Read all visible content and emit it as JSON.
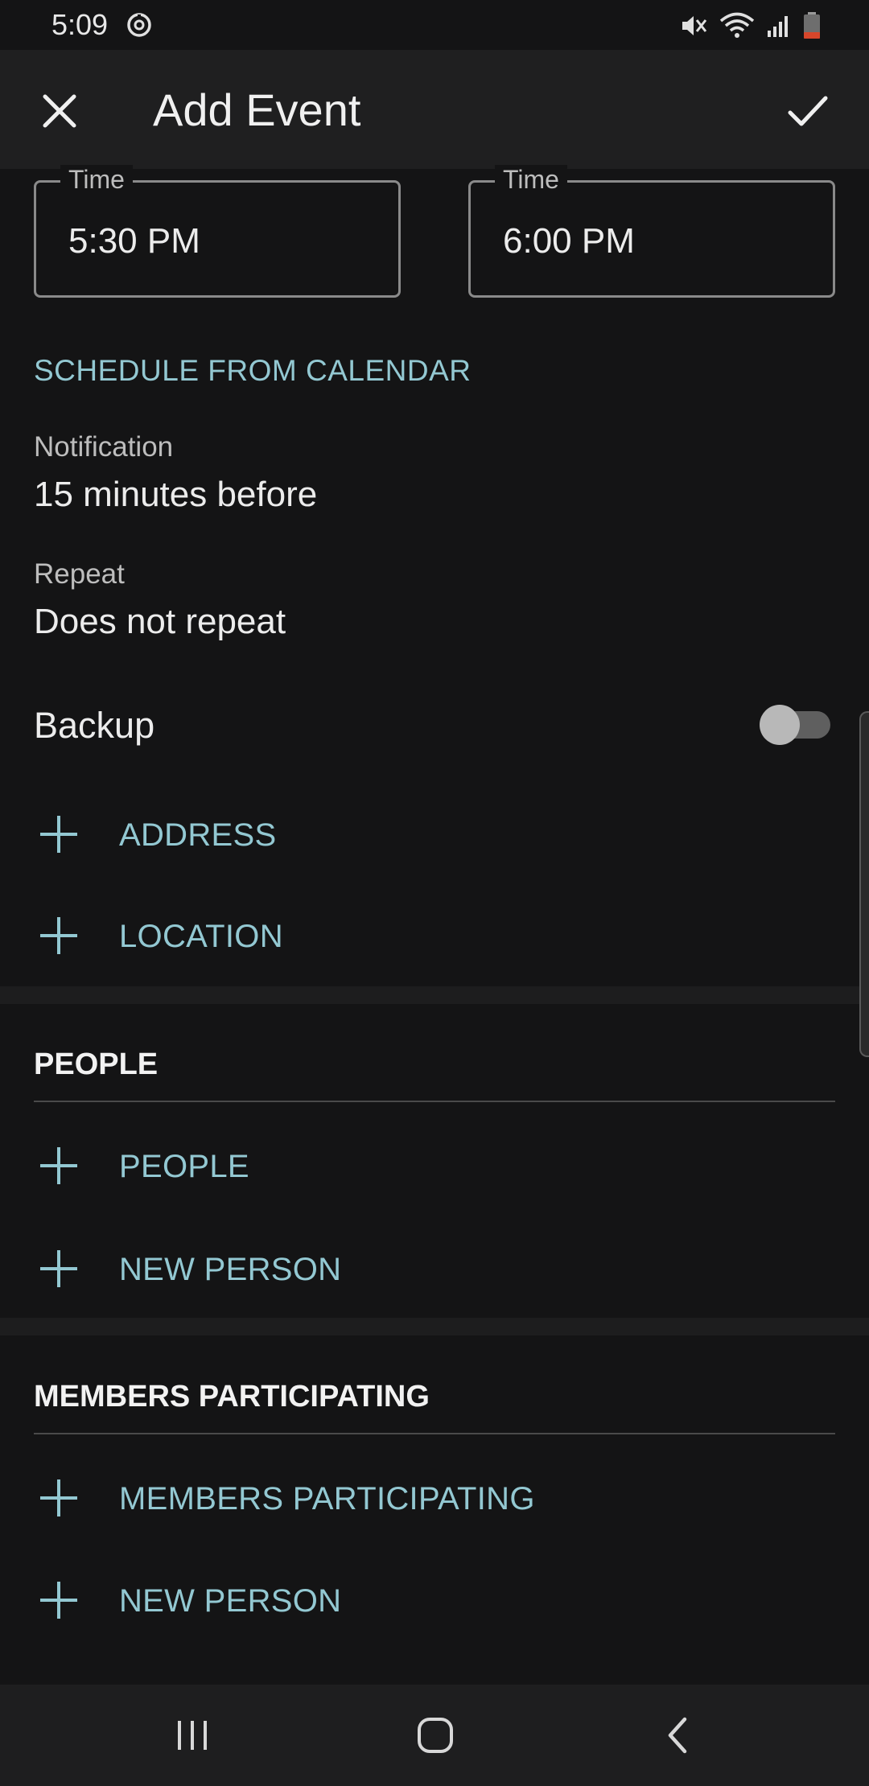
{
  "status_bar": {
    "time": "5:09"
  },
  "app_bar": {
    "title": "Add Event"
  },
  "time_fields": {
    "start": {
      "label": "Time",
      "value": "5:30 PM"
    },
    "end": {
      "label": "Time",
      "value": "6:00 PM"
    }
  },
  "schedule_link": "SCHEDULE FROM CALENDAR",
  "notification": {
    "label": "Notification",
    "value": "15 minutes before"
  },
  "repeat": {
    "label": "Repeat",
    "value": "Does not repeat"
  },
  "backup": {
    "label": "Backup",
    "enabled": false
  },
  "location_actions": {
    "address": "ADDRESS",
    "location": "LOCATION"
  },
  "people_section": {
    "header": "PEOPLE",
    "add_people": "PEOPLE",
    "new_person": "NEW PERSON"
  },
  "members_section": {
    "header": "MEMBERS PARTICIPATING",
    "add_members": "MEMBERS PARTICIPATING",
    "new_person": "NEW PERSON"
  },
  "colors": {
    "accent": "#93c8d2",
    "background": "#141415",
    "app_bar": "#1f1f20"
  }
}
